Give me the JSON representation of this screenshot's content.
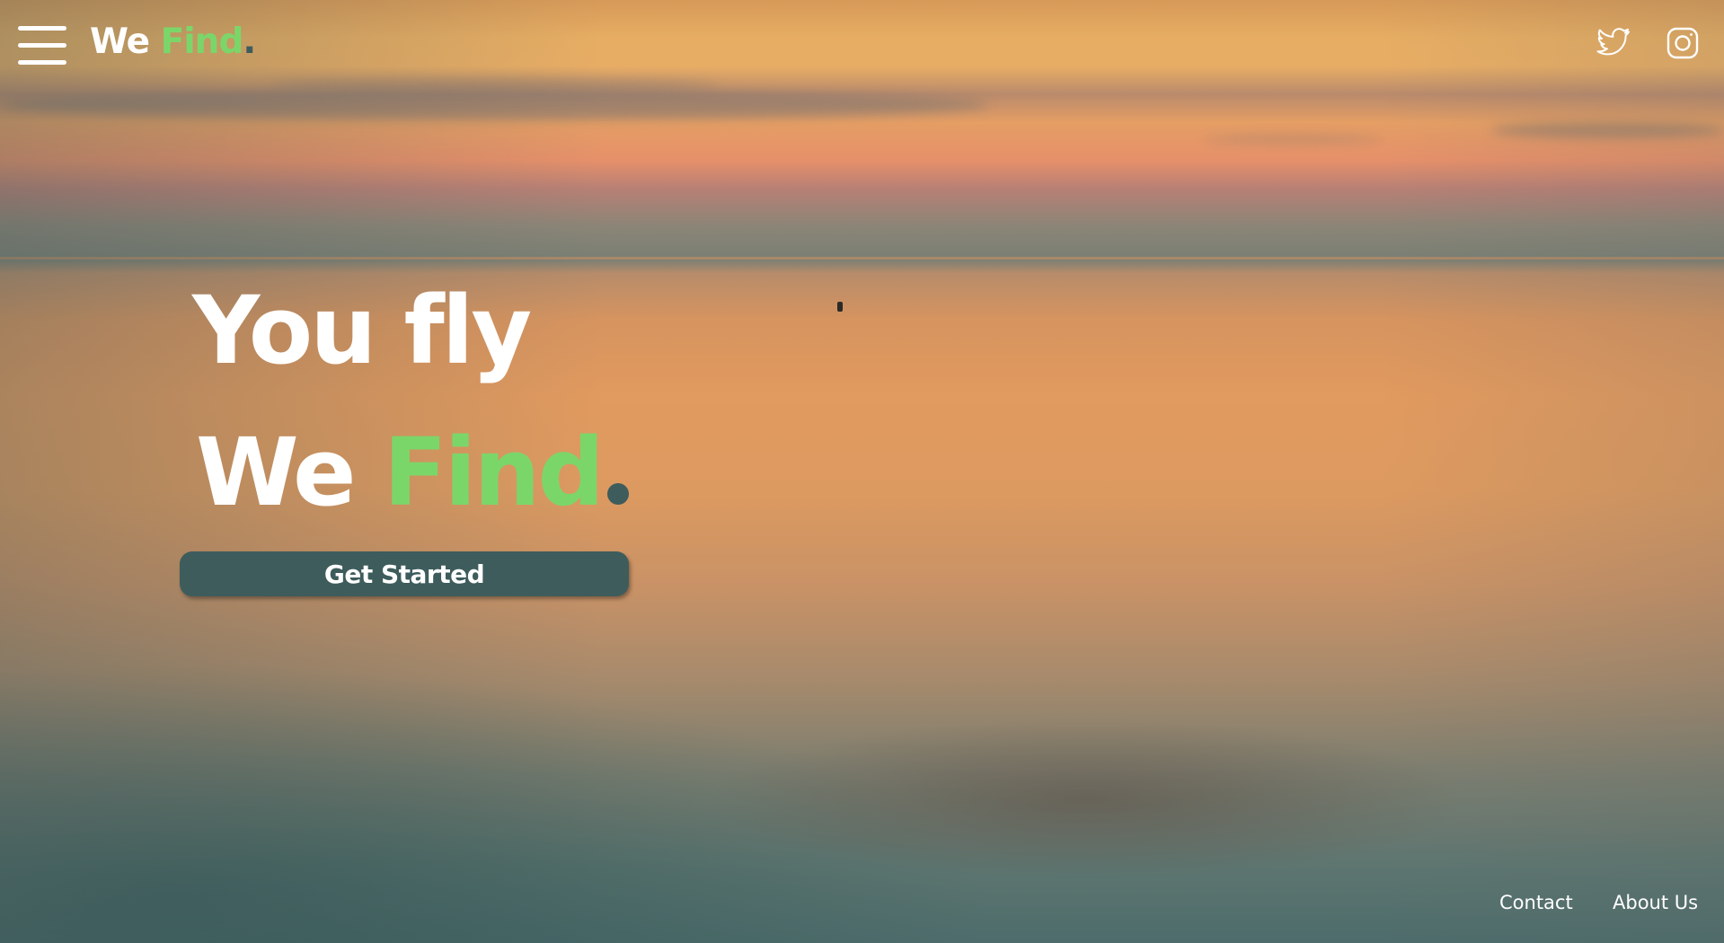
{
  "header": {
    "menu_icon": "hamburger-menu-icon",
    "logo": {
      "we": "We",
      "find": "Find",
      "dot": "."
    },
    "social": [
      {
        "icon": "twitter-icon"
      },
      {
        "icon": "instagram-icon"
      }
    ]
  },
  "hero": {
    "line1": "You fly",
    "line2_we": "We",
    "line2_find": "Find",
    "cta_label": "Get Started"
  },
  "footer": {
    "contact": "Contact",
    "about": "About Us"
  },
  "colors": {
    "accent_green": "#7bd66a",
    "dark_teal": "#3e5c5c",
    "text_white": "#ffffff"
  }
}
